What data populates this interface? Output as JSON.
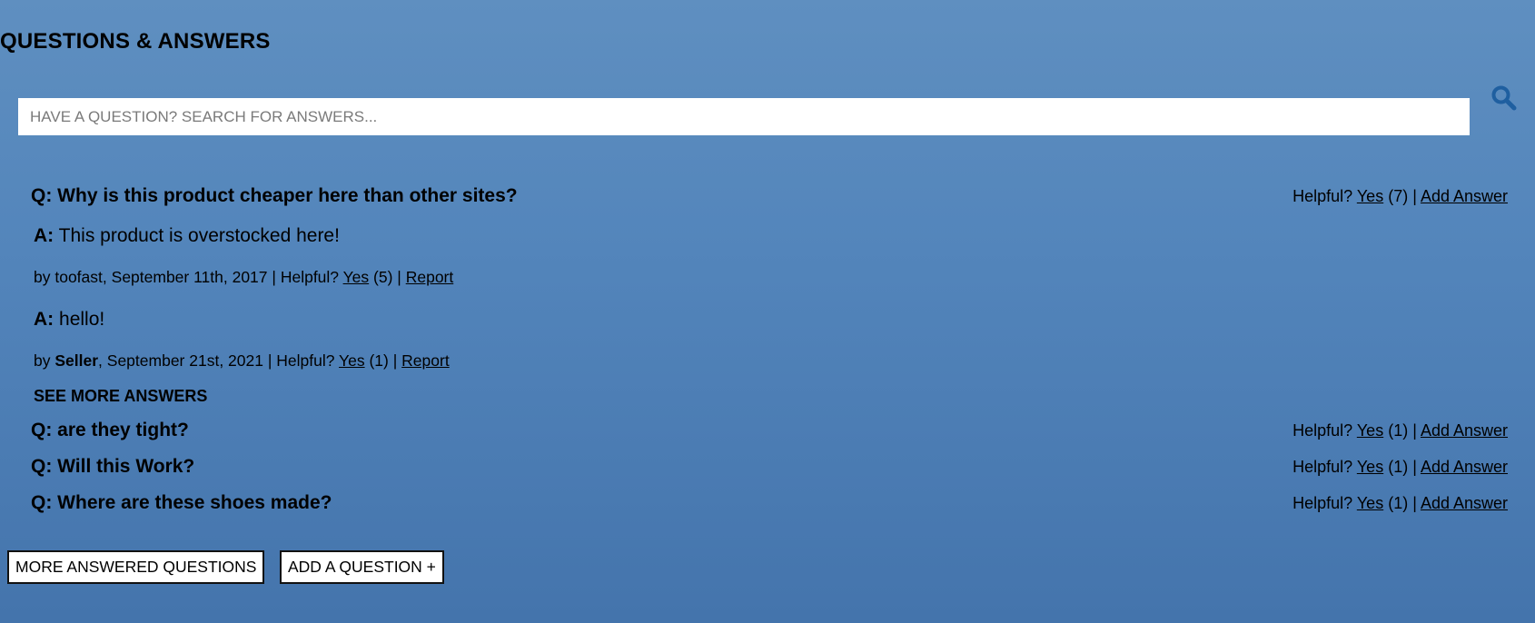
{
  "header": {
    "title": "QUESTIONS & ANSWERS"
  },
  "search": {
    "placeholder": "HAVE A QUESTION? SEARCH FOR ANSWERS...",
    "value": "",
    "icon": "search-icon",
    "icon_color": "#1f5fa0"
  },
  "labels": {
    "helpful": "Helpful?",
    "yes": "Yes",
    "add_answer": "Add Answer",
    "report": "Report",
    "by": "by",
    "separator": "|",
    "q_prefix": "Q:",
    "a_prefix": "A:"
  },
  "questions": [
    {
      "text": "Why is this product cheaper here than other sites?",
      "helpful_count": "(7)",
      "answers": [
        {
          "text": "This product is overstocked here!",
          "user": "toofast",
          "date": "September 11th, 2017",
          "helpful_count": "(5)"
        },
        {
          "text": "hello!",
          "user": "Seller",
          "date": "September 21st, 2021",
          "helpful_count": "(1)"
        }
      ],
      "see_more_label": "SEE MORE ANSWERS"
    },
    {
      "text": "are they tight?",
      "helpful_count": "(1)"
    },
    {
      "text": "Will this Work?",
      "helpful_count": "(1)"
    },
    {
      "text": "Where are these shoes made?",
      "helpful_count": "(1)"
    }
  ],
  "buttons": {
    "more_questions": "MORE ANSWERED QUESTIONS",
    "add_question": "ADD A QUESTION +"
  },
  "colors": {
    "background_top": "#5f8fc0",
    "background_bottom": "#4474ac",
    "accent": "#1f5fa0"
  }
}
